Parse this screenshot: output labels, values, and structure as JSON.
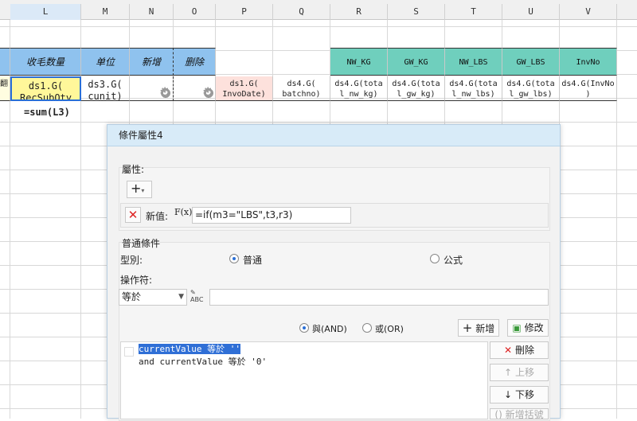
{
  "columns": [
    "L",
    "M",
    "N",
    "O",
    "P",
    "Q",
    "R",
    "S",
    "T",
    "U",
    "V"
  ],
  "header_row": {
    "L": "收毛数量",
    "M": "单位",
    "N": "新增",
    "O": "删除",
    "R": "NW_KG",
    "S": "GW_KG",
    "T": "NW_LBS",
    "U": "GW_LBS",
    "V": "InvNo"
  },
  "data_row": {
    "left_partial": "翻",
    "L": "ds1.G(\nRecSubQty",
    "M": "ds3.G(\ncunit)",
    "P": "ds1.G(\nInvoDate)",
    "Q": "ds4.G(\nbatchno)",
    "R": "ds4.G(tota\nl_nw_kg)",
    "S": "ds4.G(tota\nl_gw_kg)",
    "T": "ds4.G(tota\nl_nw_lbs)",
    "U": "ds4.G(tota\nl_gw_lbs)",
    "V": "ds4.G(InvNo\n)"
  },
  "sum_cell": "=sum(L3)",
  "dialog": {
    "title": "條件屬性4",
    "attr_section_label": "屬性:",
    "add_symbol": "+",
    "new_value_label": "新值:",
    "fx_label": "F(x)",
    "new_value_formula": "=if(m3=\"LBS\",t3,r3)",
    "common_section_label": "普通條件",
    "type_label": "型別:",
    "type_normal": "普通",
    "type_formula": "公式",
    "operator_label": "操作符:",
    "operator_value": "等於",
    "operator_input_value": "",
    "and_label": "與(AND)",
    "or_label": "或(OR)",
    "add_button": "新增",
    "modify_button": "修改",
    "conditions": [
      "currentValue 等於 ''",
      "and currentValue 等於 '0'"
    ],
    "delete_button": "刪除",
    "move_up_button": "上移",
    "move_down_button": "下移",
    "add_bracket_button": "新增括號"
  },
  "colors": {
    "header_blue": "#8fc2ee",
    "header_teal": "#6fcfbd",
    "highlight": "#2f6fd6",
    "dialog_title_bg": "#d8ebf8"
  }
}
